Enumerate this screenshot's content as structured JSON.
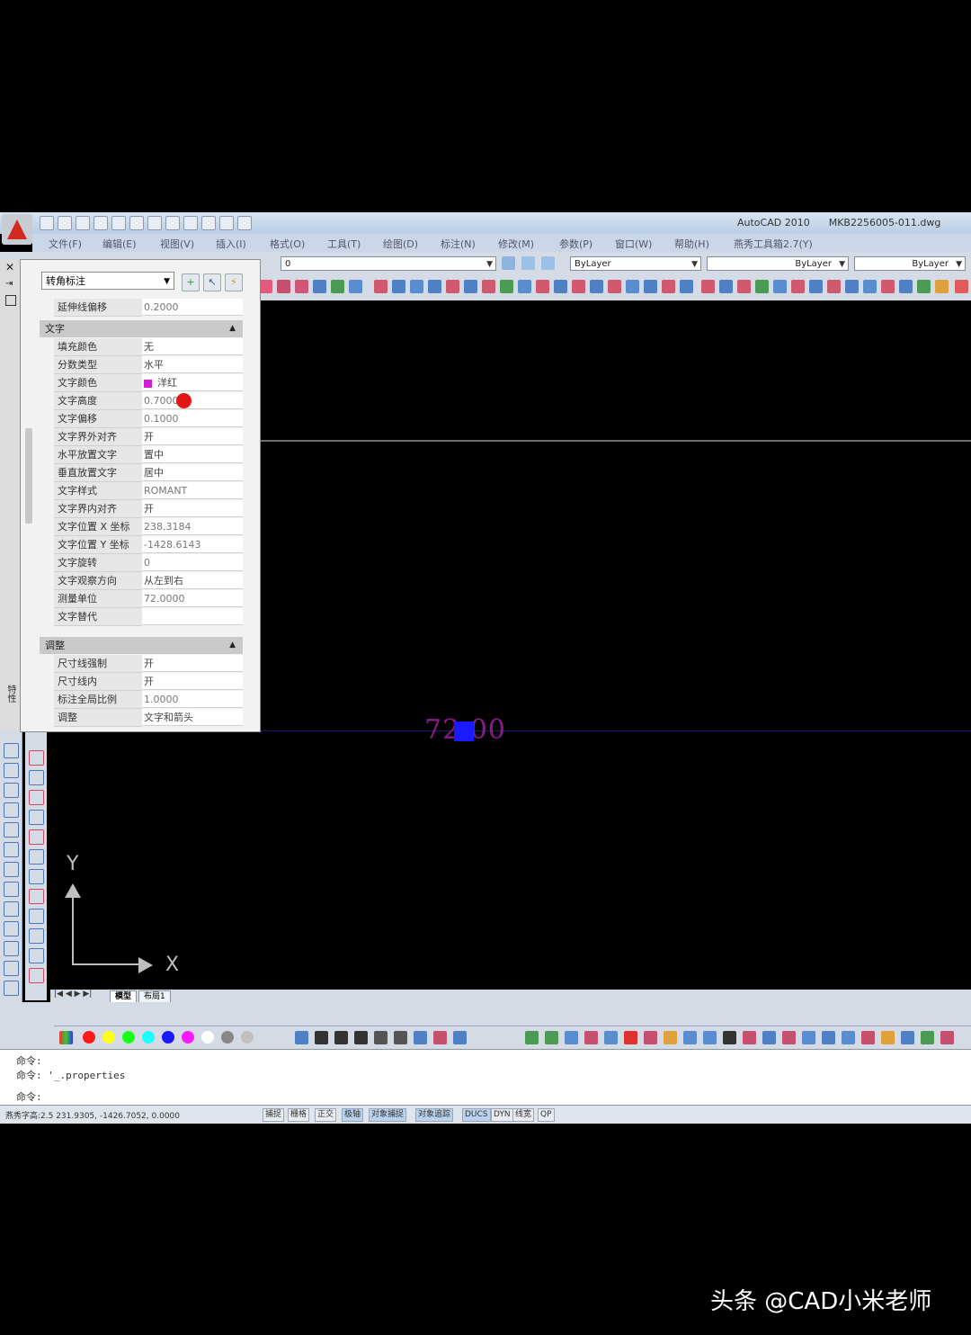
{
  "app": {
    "title": "AutoCAD 2010",
    "filename": "MKB2256005-011.dwg"
  },
  "menu": [
    "文件(F)",
    "编辑(E)",
    "视图(V)",
    "插入(I)",
    "格式(O)",
    "工具(T)",
    "绘图(D)",
    "标注(N)",
    "修改(M)",
    "参数(P)",
    "窗口(W)",
    "帮助(H)",
    "燕秀工具箱2.7(Y)"
  ],
  "toolbar": {
    "layer_value": "0",
    "color_value": "ByLayer",
    "linetype_value": "ByLayer",
    "lineweight_value": "ByLayer"
  },
  "properties": {
    "object_type": "转角标注",
    "top_row": {
      "label": "延伸线偏移",
      "value": "0.2000"
    },
    "sections": [
      {
        "title": "文字",
        "toggle": "▲",
        "rows": [
          {
            "label": "填充颜色",
            "value": "无"
          },
          {
            "label": "分数类型",
            "value": "水平"
          },
          {
            "label": "文字颜色",
            "value": "洋红",
            "swatch": "#d21ed2"
          },
          {
            "label": "文字高度",
            "value": "0.7000"
          },
          {
            "label": "文字偏移",
            "value": "0.1000"
          },
          {
            "label": "文字界外对齐",
            "value": "开"
          },
          {
            "label": "水平放置文字",
            "value": "置中"
          },
          {
            "label": "垂直放置文字",
            "value": "居中"
          },
          {
            "label": "文字样式",
            "value": "ROMANT"
          },
          {
            "label": "文字界内对齐",
            "value": "开"
          },
          {
            "label": "文字位置 X 坐标",
            "value": "238.3184"
          },
          {
            "label": "文字位置 Y 坐标",
            "value": "-1428.6143"
          },
          {
            "label": "文字旋转",
            "value": "0"
          },
          {
            "label": "文字观察方向",
            "value": "从左到右"
          },
          {
            "label": "测量单位",
            "value": "72.0000"
          },
          {
            "label": "文字替代",
            "value": ""
          }
        ]
      },
      {
        "title": "调整",
        "toggle": "▲",
        "rows": [
          {
            "label": "尺寸线强制",
            "value": "开"
          },
          {
            "label": "尺寸线内",
            "value": "开"
          },
          {
            "label": "标注全局比例",
            "value": "1.0000"
          },
          {
            "label": "调整",
            "value": "文字和箭头"
          }
        ]
      }
    ],
    "side_label": "特性"
  },
  "drawing": {
    "dimension_text": "72.00",
    "ucs_x": "X",
    "ucs_y": "Y"
  },
  "tabs": {
    "model": "模型",
    "layout": "布局1"
  },
  "command": {
    "lines": [
      "命令:",
      "命令: '_.properties",
      "命令:"
    ]
  },
  "status": {
    "coords": "燕秀字高:2.5  231.9305, -1426.7052, 0.0000",
    "buttons": [
      {
        "label": "捕捉",
        "on": false
      },
      {
        "label": "栅格",
        "on": false
      },
      {
        "label": "正交",
        "on": false
      },
      {
        "label": "极轴",
        "on": true
      },
      {
        "label": "对象捕捉",
        "on": true
      },
      {
        "label": "对象追踪",
        "on": true
      },
      {
        "label": "DUCS",
        "on": true
      },
      {
        "label": "DYN",
        "on": false
      },
      {
        "label": "线宽",
        "on": false
      },
      {
        "label": "QP",
        "on": false
      }
    ]
  },
  "watermark": "头条 @CAD小米老师",
  "colors": {
    "dimension": "#8b1a8c",
    "cursor_marker": "#e21616",
    "magenta_swatch": "#d21ed2"
  }
}
